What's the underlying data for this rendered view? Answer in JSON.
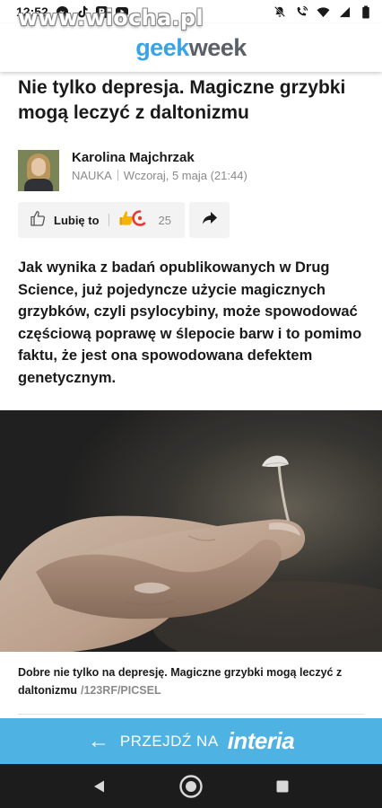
{
  "status_bar": {
    "time": "12:52",
    "watermark": "www.wiocha.pl"
  },
  "header": {
    "logo_part1": "geek",
    "logo_part2": "week"
  },
  "article": {
    "title": "Nie tylko depresja. Magiczne grzybki mogą leczyć z daltonizmu",
    "author": "Karolina Majchrzak",
    "category": "NAUKA",
    "date": "Wczoraj, 5 maja (21:44)",
    "lead": "Jak wynika z badań opublikowanych w Drug Science, już pojedyncze użycie magicznych grzybków, czyli psylocybiny, może spowodować częściową poprawę w ślepocie barw i to pomimo faktu, że jest ona spowodowana defektem genetycznym.",
    "caption": "Dobre nie tylko na depresję. Magiczne grzybki mogą leczyć z daltonizmu",
    "caption_credit": "/123RF/PICSEL"
  },
  "actions": {
    "like_label": "Lubię to",
    "like_count": "25"
  },
  "banner": {
    "arrow": "←",
    "go_label": "PRZEJDŹ NA",
    "brand": "interia"
  },
  "colors": {
    "accent": "#4eb3e3",
    "logo_blue": "#3aa3e3",
    "logo_grey": "#5b6068",
    "nav_bg": "#1c1c1c"
  }
}
